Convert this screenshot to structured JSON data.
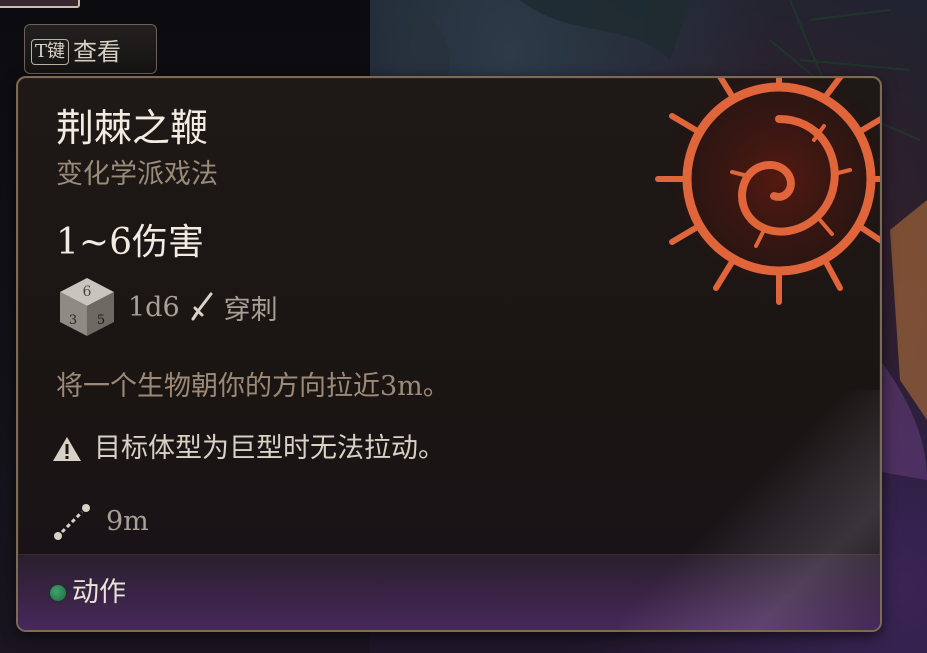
{
  "key_hint": {
    "key": "T键",
    "label": "查看"
  },
  "spell": {
    "name": "荆棘之鞭",
    "school": "变化学派戏法",
    "damage": "1~6伤害",
    "dice": "1d6",
    "damage_type": "穿刺",
    "description": "将一个生物朝你的方向拉近3m。",
    "warning": "目标体型为巨型时无法拉动。",
    "range": "9m",
    "cost_label": "动作"
  },
  "icons": {
    "spell": "thorn-whip-spell-icon",
    "die": "d6-die-icon",
    "damage_type": "piercing-icon",
    "warning": "warning-icon",
    "range": "range-icon",
    "action": "action-resource-dot"
  },
  "colors": {
    "title": "#f1ebe1",
    "subtitle": "#9a8b78",
    "description": "#9c8a76",
    "action_dot": "#2f8a54",
    "spell_glow": "#e0653a",
    "panel_border": "#7d6a54"
  }
}
